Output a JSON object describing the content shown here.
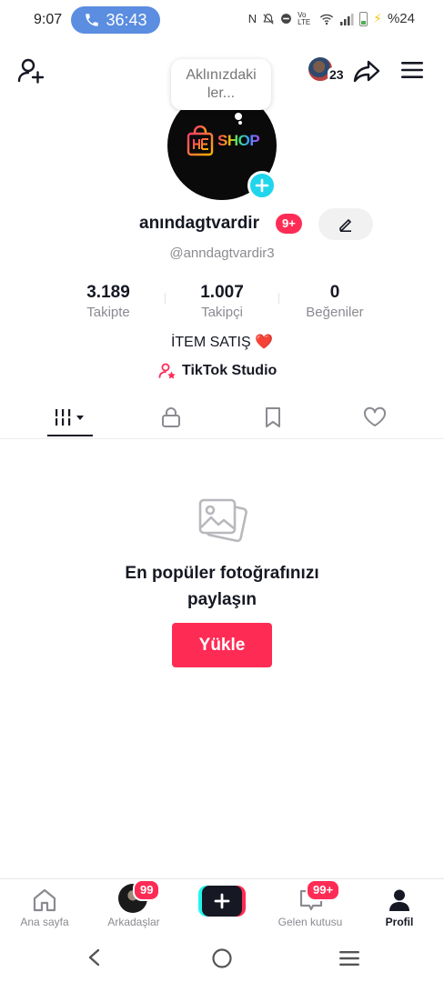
{
  "status_bar": {
    "time": "9:07",
    "call_timer": "36:43",
    "icons": [
      "nfc-icon",
      "mute-icon",
      "dnd-icon",
      "volte-icon",
      "wifi-icon",
      "signal-icon",
      "battery-icon"
    ],
    "volte_text": "Vo LTE",
    "battery_percent": "%24"
  },
  "top_bar": {
    "friend_avatar_count": "23",
    "bubble_text": "Aklınızdaki ler..."
  },
  "profile": {
    "avatar_logo_text": "SHOP",
    "username": "anındagtvardir",
    "username_badge": "9+",
    "handle": "@anndagtvardir3",
    "stats": [
      {
        "value": "3.189",
        "label": "Takipte"
      },
      {
        "value": "1.007",
        "label": "Takipçi"
      },
      {
        "value": "0",
        "label": "Beğeniler"
      }
    ],
    "bio_text": "İTEM SATIŞ",
    "bio_emoji": "❤️",
    "studio_link": "TikTok Studio"
  },
  "tabs": [
    {
      "icon": "grid-icon",
      "active": true
    },
    {
      "icon": "lock-icon",
      "active": false
    },
    {
      "icon": "bookmark-icon",
      "active": false
    },
    {
      "icon": "heart-icon",
      "active": false
    }
  ],
  "empty_state": {
    "title_line1": "En popüler fotoğrafınızı",
    "title_line2": "paylaşın",
    "button_label": "Yükle"
  },
  "bottom_nav": {
    "home_label": "Ana sayfa",
    "friends_label": "Arkadaşlar",
    "friends_badge": "99",
    "inbox_label": "Gelen kutusu",
    "inbox_badge": "99+",
    "profile_label": "Profil"
  },
  "colors": {
    "accent": "#fe2c55",
    "cyan": "#25f4ee",
    "call_pill": "#5b8de0",
    "text": "#161823",
    "muted": "#8a8b91"
  }
}
